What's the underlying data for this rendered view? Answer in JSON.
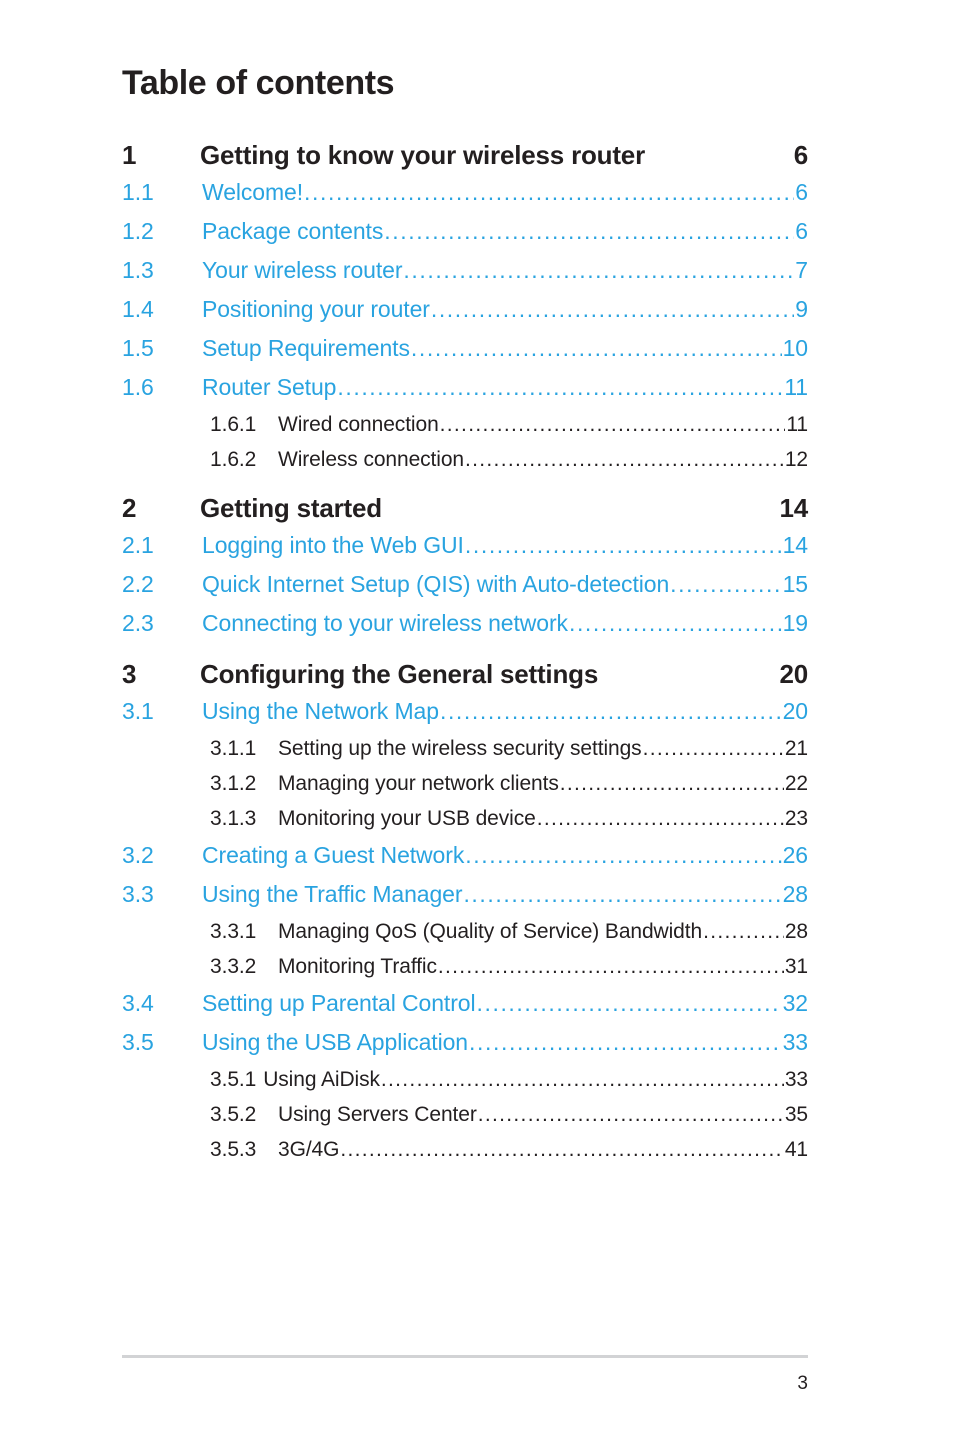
{
  "document": {
    "title": "Table of contents",
    "footer_page_number": "3",
    "accent_color": "#29a3e0",
    "text_color": "#231f20",
    "rule_color": "#d2d3d5"
  },
  "toc": {
    "chapters": [
      {
        "number": "1",
        "label": "Getting to know your wireless router",
        "page": "6",
        "entries": [
          {
            "level": 2,
            "number": "1.1",
            "label": "Welcome!",
            "page": "6",
            "gap": "wide"
          },
          {
            "level": 2,
            "number": "1.2",
            "label": "Package contents",
            "page": "6",
            "gap": "none"
          },
          {
            "level": 2,
            "number": "1.3",
            "label": "Your wireless router",
            "page": "7",
            "gap": "none"
          },
          {
            "level": 2,
            "number": "1.4",
            "label": "Positioning your router",
            "page": "9",
            "gap": "wide"
          },
          {
            "level": 2,
            "number": "1.5",
            "label": "Setup Requirements",
            "page": "10",
            "gap": "wide"
          },
          {
            "level": 2,
            "number": "1.6",
            "label": "Router Setup",
            "page": "11",
            "gap": "none"
          },
          {
            "level": 3,
            "number": "1.6.1",
            "label": "Wired connection",
            "page": "11",
            "gap": "none"
          },
          {
            "level": 3,
            "number": "1.6.2",
            "label": "Wireless connection",
            "page": "12",
            "gap": "wide"
          }
        ]
      },
      {
        "number": "2",
        "label": "Getting started",
        "page": "14",
        "entries": [
          {
            "level": 2,
            "number": "2.1",
            "label": "Logging into the Web GUI",
            "page": "14",
            "gap": "wide"
          },
          {
            "level": 2,
            "number": "2.2",
            "label": "Quick Internet Setup (QIS) with Auto-detection",
            "page": "15",
            "gap": "wide"
          },
          {
            "level": 2,
            "number": "2.3",
            "label": "Connecting to your wireless network",
            "page": "19",
            "gap": "none"
          }
        ]
      },
      {
        "number": "3",
        "label": "Configuring the General settings",
        "page": "20",
        "entries": [
          {
            "level": 2,
            "number": "3.1",
            "label": "Using the Network Map",
            "page": "20",
            "gap": "wide"
          },
          {
            "level": 3,
            "number": "3.1.1",
            "label": "Setting up the wireless security settings",
            "page": "21",
            "gap": "none"
          },
          {
            "level": 3,
            "number": "3.1.2",
            "label": "Managing your network clients",
            "page": "22",
            "gap": "none"
          },
          {
            "level": 3,
            "number": "3.1.3",
            "label": "Monitoring your USB device",
            "page": "23",
            "gap": "wide"
          },
          {
            "level": 2,
            "number": "3.2",
            "label": "Creating a Guest Network",
            "page": "26",
            "gap": "none"
          },
          {
            "level": 2,
            "number": "3.3",
            "label": "Using the Traffic Manager",
            "page": "28",
            "gap": "wide"
          },
          {
            "level": 3,
            "number": "3.3.1",
            "label": "Managing QoS (Quality of Service) Bandwidth",
            "page": "28",
            "gap": "none"
          },
          {
            "level": 3,
            "number": "3.3.2",
            "label": "Monitoring Traffic",
            "page": "31",
            "gap": "wide"
          },
          {
            "level": 2,
            "number": "3.4",
            "label": "Setting up Parental Control",
            "page": "32",
            "gap": "none"
          },
          {
            "level": 2,
            "number": "3.5",
            "label": "Using the USB Application",
            "page": "33",
            "gap": "none"
          },
          {
            "level": 3,
            "number": "3.5.1",
            "label": "Using AiDisk",
            "page": "33",
            "gap": "none",
            "tight": true
          },
          {
            "level": 3,
            "number": "3.5.2",
            "label": "Using Servers Center",
            "page": "35",
            "gap": "none"
          },
          {
            "level": 3,
            "number": "3.5.3",
            "label": "3G/4G",
            "page": "41",
            "gap": "wide"
          }
        ]
      }
    ]
  }
}
